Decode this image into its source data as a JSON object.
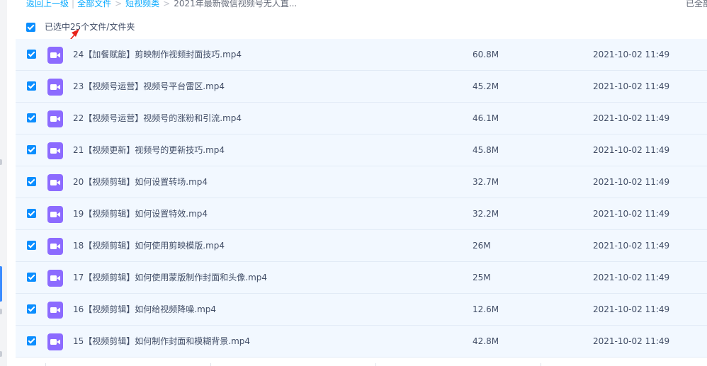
{
  "breadcrumb": {
    "back": "返回上一级",
    "all_files": "全部文件",
    "folder": "短视频类",
    "current": "2021年最新微信视频号无人直..."
  },
  "top_right_status": "已全部",
  "selection": {
    "label": "已选中25个文件/文件夹"
  },
  "icon_color": "#8c6bff",
  "accent_color": "#0b8eff",
  "files": [
    {
      "name": "24【加餐赋能】剪映制作视频封面技巧.mp4",
      "size": "60.8M",
      "date": "2021-10-02 11:49"
    },
    {
      "name": "23【视频号运营】视频号平台雷区.mp4",
      "size": "45.2M",
      "date": "2021-10-02 11:49"
    },
    {
      "name": "22【视频号运营】视频号的涨粉和引流.mp4",
      "size": "46.1M",
      "date": "2021-10-02 11:49"
    },
    {
      "name": "21【视频更新】视频号的更新技巧.mp4",
      "size": "45.8M",
      "date": "2021-10-02 11:49"
    },
    {
      "name": "20【视频剪辑】如何设置转场.mp4",
      "size": "32.7M",
      "date": "2021-10-02 11:49"
    },
    {
      "name": "19【视频剪辑】如何设置特效.mp4",
      "size": "32.2M",
      "date": "2021-10-02 11:49"
    },
    {
      "name": "18【视频剪辑】如何使用剪映模版.mp4",
      "size": "26M",
      "date": "2021-10-02 11:49"
    },
    {
      "name": "17【视频剪辑】如何使用蒙版制作封面和头像.mp4",
      "size": "25M",
      "date": "2021-10-02 11:49"
    },
    {
      "name": "16【视频剪辑】如何给视频降噪.mp4",
      "size": "12.6M",
      "date": "2021-10-02 11:49"
    },
    {
      "name": "15【视频剪辑】如何制作封面和模糊背景.mp4",
      "size": "42.8M",
      "date": "2021-10-02 11:49"
    }
  ]
}
